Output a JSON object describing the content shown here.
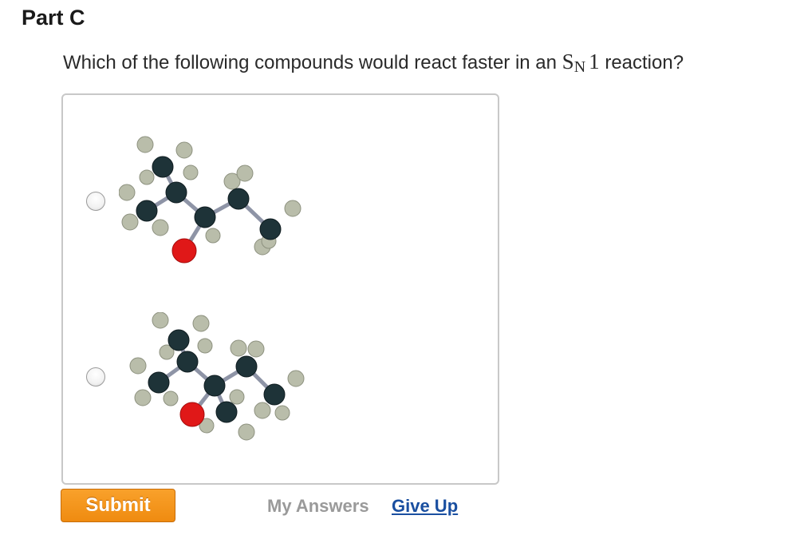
{
  "part": {
    "title": "Part C"
  },
  "question": {
    "prefix": "Which of the following compounds would react faster in an ",
    "sn_main": "S",
    "sn_sub": "N",
    "sn_number": "1",
    "suffix": " reaction?"
  },
  "options": [
    {
      "selected": false,
      "image_icon": "molecule-ball-and-stick"
    },
    {
      "selected": false,
      "image_icon": "molecule-ball-and-stick"
    }
  ],
  "colors": {
    "carbon": "#1e3338",
    "hydrogen": "#b9bdaa",
    "oxygen": "#e01818",
    "bond": "#8e94a6",
    "submit": "#f39416",
    "link": "#1a4fa0",
    "disabled": "#9a9a9a"
  },
  "actions": {
    "submit_label": "Submit",
    "my_answers_label": "My Answers",
    "give_up_label": "Give Up"
  }
}
